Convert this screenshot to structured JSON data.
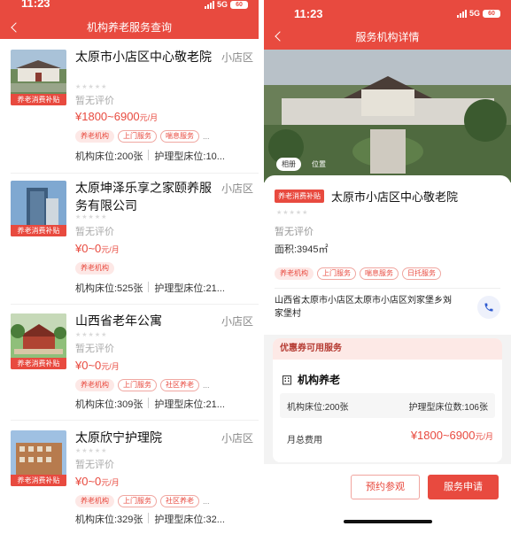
{
  "status": {
    "time": "11:23",
    "network": "5G",
    "battery": "60"
  },
  "colors": {
    "brand_red": "#e84a3f",
    "tag_border": "#f0a7a1",
    "coupon_bg": "#fde9e6"
  },
  "list_screen": {
    "title": "机构养老服务查询",
    "items": [
      {
        "name": "太原市小店区中心敬老院",
        "district": "小店区",
        "badge": "养老消费补贴",
        "rating": "暂无评价",
        "price": "¥1800~6900",
        "price_unit": "元/月",
        "tags": [
          "养老机构",
          "上门服务",
          "喘息服务"
        ],
        "more": "...",
        "beds": "机构床位:200张",
        "nursing_beds": "护理型床位:10..."
      },
      {
        "name": "太原坤泽乐享之家颐养服务有限公司",
        "district": "小店区",
        "badge": "养老消费补贴",
        "rating": "暂无评价",
        "price": "¥0~0",
        "price_unit": "元/月",
        "tags": [
          "养老机构"
        ],
        "more": "",
        "beds": "机构床位:525张",
        "nursing_beds": "护理型床位:21..."
      },
      {
        "name": "山西省老年公寓",
        "district": "小店区",
        "badge": "养老消费补贴",
        "rating": "暂无评价",
        "price": "¥0~0",
        "price_unit": "元/月",
        "tags": [
          "养老机构",
          "上门服务",
          "社区养老"
        ],
        "more": "...",
        "beds": "机构床位:309张",
        "nursing_beds": "护理型床位:21..."
      },
      {
        "name": "太原欣宁护理院",
        "district": "小店区",
        "badge": "养老消费补贴",
        "rating": "暂无评价",
        "price": "¥0~0",
        "price_unit": "元/月",
        "tags": [
          "养老机构",
          "上门服务",
          "社区养老"
        ],
        "more": "...",
        "beds": "机构床位:329张",
        "nursing_beds": "护理型床位:32..."
      }
    ]
  },
  "detail_screen": {
    "title": "服务机构详情",
    "photo_tabs": [
      "相册",
      "位置"
    ],
    "badge": "养老消费补贴",
    "name": "太原市小店区中心敬老院",
    "rating": "暂无评价",
    "area": "面积:3945㎡",
    "tags": [
      "养老机构",
      "上门服务",
      "喘息服务",
      "日托服务"
    ],
    "address": "山西省太原市小店区太原市小店区刘家堡乡刘家堡村",
    "coupon_header": "优惠券可用服务",
    "service_title": "机构养老",
    "service_beds": "机构床位:200张",
    "service_nursing_beds": "护理型床位数:106张",
    "fee_label": "月总费用",
    "fee_value": "¥1800~6900",
    "fee_unit": "元/月",
    "buttons": {
      "visit": "预约参观",
      "apply": "服务申请"
    }
  }
}
